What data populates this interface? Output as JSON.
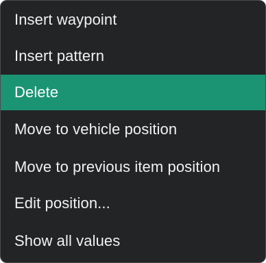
{
  "context_menu": {
    "items": [
      {
        "label": "Insert waypoint"
      },
      {
        "label": "Insert pattern"
      },
      {
        "label": "Delete",
        "state": "highlighted"
      },
      {
        "label": "Move to vehicle position"
      },
      {
        "label": "Move to previous item position"
      },
      {
        "label": "Edit position..."
      },
      {
        "label": "Show all values"
      }
    ],
    "colors": {
      "background": "#222426",
      "highlight": "#1b9473",
      "text": "#f2f2f2"
    }
  }
}
